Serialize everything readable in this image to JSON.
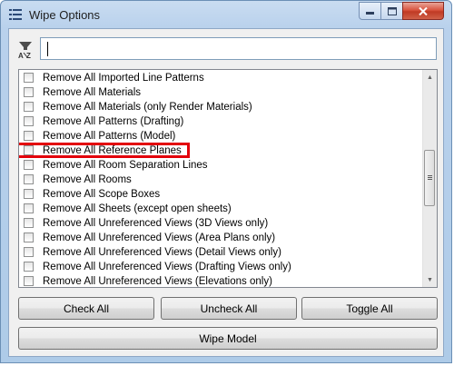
{
  "window": {
    "title": "Wipe Options",
    "controls": {
      "minimize_icon": "minimize-icon",
      "maximize_icon": "maximize-icon",
      "close_icon": "close-icon"
    }
  },
  "search": {
    "value": "",
    "placeholder": "",
    "sort_icon": "sort-az-filter-icon"
  },
  "list": {
    "items": [
      {
        "label": "Remove All Imported Line Patterns",
        "checked": false
      },
      {
        "label": "Remove All Materials",
        "checked": false
      },
      {
        "label": "Remove All Materials (only Render Materials)",
        "checked": false
      },
      {
        "label": "Remove All Patterns (Drafting)",
        "checked": false
      },
      {
        "label": "Remove All Patterns (Model)",
        "checked": false
      },
      {
        "label": "Remove All Reference Planes",
        "checked": false,
        "highlighted": true
      },
      {
        "label": "Remove All Room Separation Lines",
        "checked": false
      },
      {
        "label": "Remove All Rooms",
        "checked": false
      },
      {
        "label": "Remove All Scope Boxes",
        "checked": false
      },
      {
        "label": "Remove All Sheets (except open sheets)",
        "checked": false
      },
      {
        "label": "Remove All Unreferenced Views (3D Views only)",
        "checked": false
      },
      {
        "label": "Remove All Unreferenced Views (Area Plans only)",
        "checked": false
      },
      {
        "label": "Remove All Unreferenced Views (Detail Views only)",
        "checked": false
      },
      {
        "label": "Remove All Unreferenced Views (Drafting Views only)",
        "checked": false
      },
      {
        "label": "Remove All Unreferenced Views (Elevations only)",
        "checked": false
      }
    ],
    "highlight_color": "#e3000b"
  },
  "buttons": {
    "check_all": "Check All",
    "uncheck_all": "Uncheck All",
    "toggle_all": "Toggle All",
    "wipe_model": "Wipe Model"
  }
}
